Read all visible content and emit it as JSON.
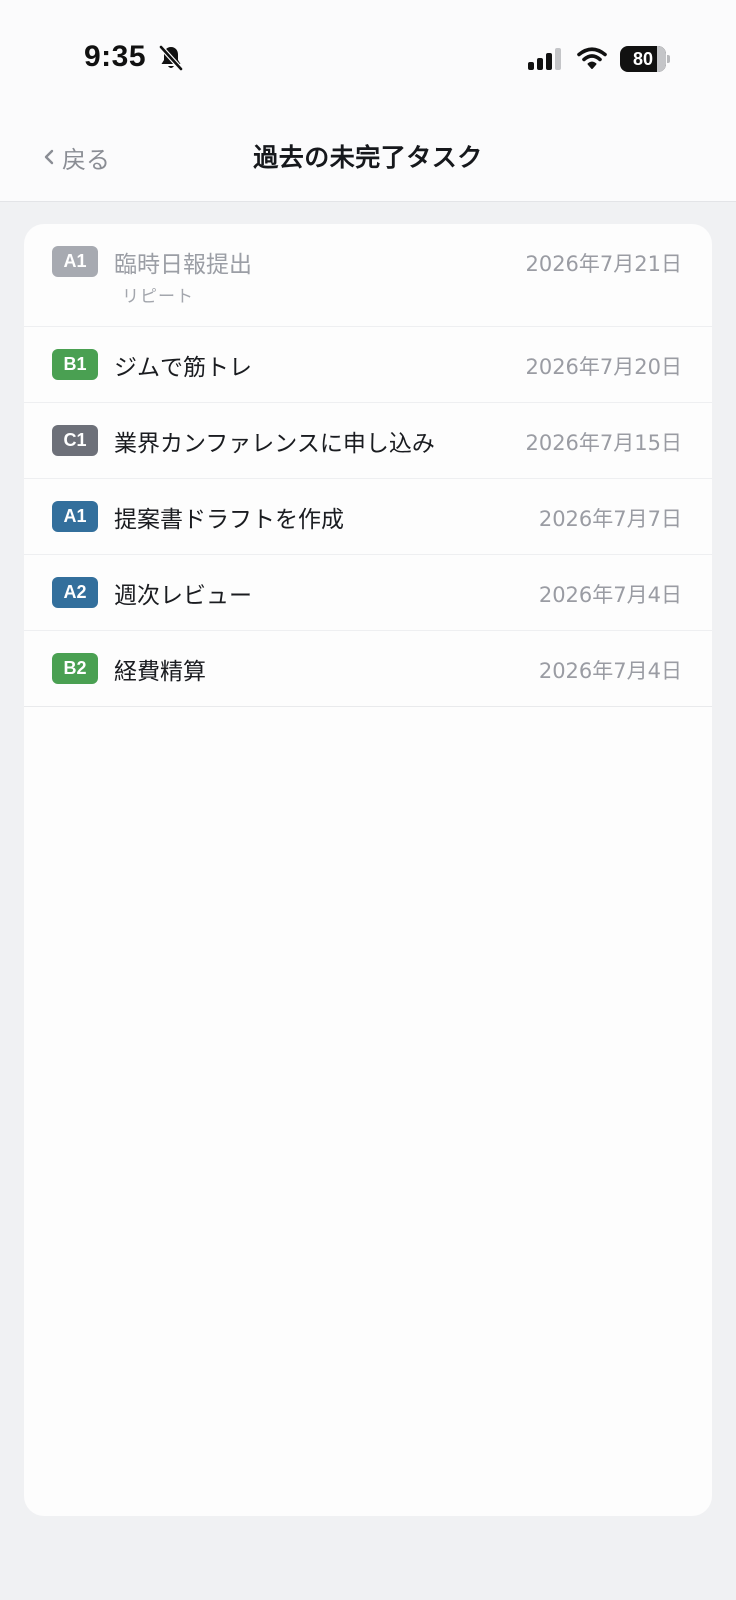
{
  "status_bar": {
    "time": "9:35",
    "silent_icon": "bell-slash-icon",
    "signal_icon": "cellular-signal-icon",
    "wifi_icon": "wifi-icon",
    "battery_level": "80",
    "battery_percent": 80
  },
  "nav": {
    "back_label": "戻る",
    "back_icon": "chevron-left-icon",
    "title": "過去の未完了タスク"
  },
  "tasks": [
    {
      "badge": "A1",
      "badge_color": "#a7aab1",
      "name": "臨時日報提出",
      "sub": "リピート",
      "date": "2026年7月21日"
    },
    {
      "badge": "B1",
      "badge_color": "#4aa052",
      "name": "ジムで筋トレ",
      "date": "2026年7月20日"
    },
    {
      "badge": "C1",
      "badge_color": "#6d7079",
      "name": "業界カンファレンスに申し込み",
      "date": "2026年7月15日"
    },
    {
      "badge": "A1",
      "badge_color": "#336f9c",
      "name": "提案書ドラフトを作成",
      "date": "2026年7月7日"
    },
    {
      "badge": "A2",
      "badge_color": "#336f9c",
      "name": "週次レビュー",
      "date": "2026年7月4日"
    },
    {
      "badge": "B2",
      "badge_color": "#4aa052",
      "name": "経費精算",
      "date": "2026年7月4日"
    }
  ],
  "colors": {
    "background": "#f0f1f3",
    "card": "#fdfdfd",
    "header": "#fbfbfc",
    "muted_text": "#9a9ca3"
  }
}
